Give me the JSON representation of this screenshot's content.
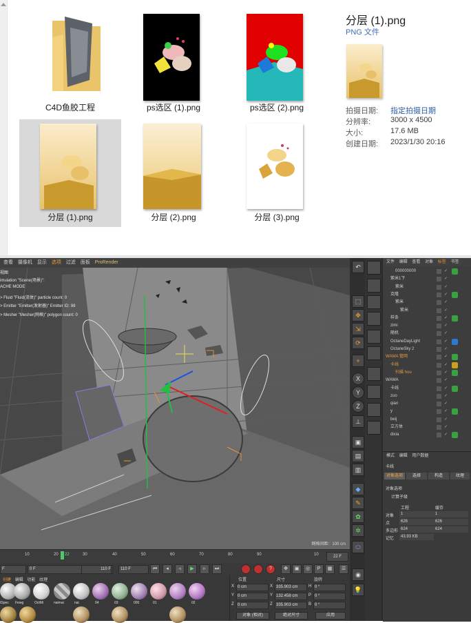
{
  "explorer": {
    "files": [
      {
        "name": "C4D鱼胶工程",
        "kind": "folder"
      },
      {
        "name": "ps选区 (1).png",
        "kind": "image"
      },
      {
        "name": "ps选区 (2).png",
        "kind": "image"
      },
      {
        "name": "分层 (1).png",
        "kind": "image",
        "selected": true
      },
      {
        "name": "分层 (2).png",
        "kind": "image"
      },
      {
        "name": "分层 (3).png",
        "kind": "image"
      }
    ],
    "preview": {
      "title": "分层 (1).png",
      "type": "PNG 文件",
      "props": [
        {
          "label": "拍摄日期:",
          "value": "指定拍摄日期"
        },
        {
          "label": "分辨率:",
          "value": "3000 x 4500"
        },
        {
          "label": "大小:",
          "value": "17.6 MB"
        },
        {
          "label": "创建日期:",
          "value": "2023/1/30 20:16"
        }
      ]
    }
  },
  "c4d": {
    "menu": [
      "查看",
      "摄像机",
      "显示",
      "选项",
      "过滤",
      "面板",
      "ProRender"
    ],
    "viewport": {
      "lines": [
        "视图",
        "imulation \"Scene(场景)\":",
        "ACHE MODE",
        "> Fluid \"Fluid(流体)\" particle count: 0",
        "> Emitter \"Emitter(发射器)\" Emitter ID: 98",
        "> Mesher \"Mesher(网格)\" polygon count: 0"
      ],
      "grid_label": "网格间距：100 cm"
    },
    "timeline": {
      "ticks": [
        "10",
        "20",
        "22",
        "30",
        "40",
        "50",
        "60",
        "70",
        "80",
        "90",
        "10"
      ],
      "current": "22 F"
    },
    "transport": {
      "start": "F",
      "frame": "0 F",
      "end": "110 F",
      "end2": "110 F"
    },
    "materials": {
      "tabs": [
        "创建",
        "编辑",
        "功能",
        "纹理"
      ],
      "names": [
        "tSpec",
        "Fewg",
        "OctMi",
        "naimai",
        "nai",
        "04",
        "03",
        "000",
        "01",
        "02"
      ]
    },
    "coords": {
      "headers": [
        "位置",
        "尺寸",
        "旋转"
      ],
      "rows": [
        {
          "axis": "X",
          "pos": "0 cm",
          "size": "335.903 cm",
          "rl": "H",
          "rot": "0 °"
        },
        {
          "axis": "Y",
          "pos": "0 cm",
          "size": "132.458 cm",
          "rl": "P",
          "rot": "0 °"
        },
        {
          "axis": "Z",
          "pos": "0 cm",
          "size": "335.903 cm",
          "rl": "B",
          "rot": "0 °"
        }
      ],
      "mode1": "对象 (相对)",
      "mode2": "绝对尺寸",
      "apply": "应用"
    },
    "objmgr": {
      "menu": [
        "文件",
        "编辑",
        "查看",
        "对象",
        "标签",
        "书签"
      ],
      "rows": [
        {
          "name": "000000000",
          "indent": 2
        },
        {
          "name": "紫米1下",
          "indent": 1
        },
        {
          "name": "紫米",
          "indent": 2
        },
        {
          "name": "克隆",
          "indent": 1
        },
        {
          "name": "紫米",
          "indent": 2
        },
        {
          "name": "紫米",
          "indent": 3
        },
        {
          "name": "样条",
          "indent": 1
        },
        {
          "name": "zimi",
          "indent": 1
        },
        {
          "name": "随机",
          "indent": 1
        },
        {
          "name": "OctaneDayLight",
          "indent": 1
        },
        {
          "name": "OctaneSky 2",
          "indent": 1
        },
        {
          "name": "WAWA 管网",
          "indent": 0,
          "hl": true
        },
        {
          "name": "卡线",
          "indent": 1,
          "hl": true
        },
        {
          "name": "扫描 hou",
          "indent": 2,
          "hl": true
        },
        {
          "name": "WAWA",
          "indent": 0
        },
        {
          "name": "卡线",
          "indent": 1
        },
        {
          "name": "zuo",
          "indent": 1
        },
        {
          "name": "qian",
          "indent": 1
        },
        {
          "name": "y",
          "indent": 1
        },
        {
          "name": "beij",
          "indent": 1
        },
        {
          "name": "立方体",
          "indent": 1
        },
        {
          "name": "dixia",
          "indent": 1
        }
      ]
    },
    "attributes": {
      "menu": [
        "模式",
        "编辑",
        "用户数据"
      ],
      "object": "卡线",
      "tabs": [
        "对象选项",
        "选择",
        "构造",
        "纹理"
      ],
      "section": "对象选项",
      "sub": "计算子级",
      "col1": "工程",
      "col2": "缓存",
      "rows": [
        {
          "k": "对象",
          "a": "1",
          "b": "1"
        },
        {
          "k": "点",
          "a": "626",
          "b": "626"
        },
        {
          "k": "多边形",
          "a": "624",
          "b": "624"
        },
        {
          "k": "记忆",
          "a": "43.93 KB",
          "b": ""
        }
      ]
    }
  }
}
